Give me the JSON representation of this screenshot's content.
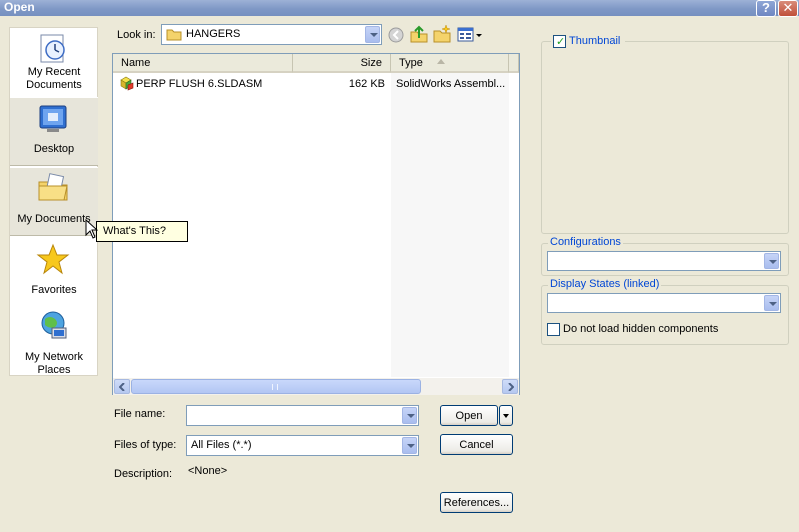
{
  "window": {
    "title": "Open",
    "help_label": "?",
    "close_label": "✕"
  },
  "places": [
    {
      "label_line1": "My Recent",
      "label_line2": "Documents",
      "icon": "recent-documents-icon"
    },
    {
      "label_line1": "Desktop",
      "label_line2": "",
      "icon": "desktop-icon"
    },
    {
      "label_line1": "My Documents",
      "label_line2": "",
      "icon": "my-documents-icon"
    },
    {
      "label_line1": "Favorites",
      "label_line2": "",
      "icon": "favorites-star-icon"
    },
    {
      "label_line1": "My Network",
      "label_line2": "Places",
      "icon": "network-places-icon"
    }
  ],
  "lookin": {
    "label": "Look in:",
    "value": "HANGERS"
  },
  "list": {
    "columns": {
      "name": "Name",
      "size": "Size",
      "type": "Type"
    },
    "rows": [
      {
        "name": "PERP FLUSH 6.SLDASM",
        "size": "162 KB",
        "type": "SolidWorks Assembl..."
      }
    ]
  },
  "fields": {
    "filename_label": "File name:",
    "filename_value": "",
    "filetype_label": "Files of type:",
    "filetype_value": "All Files (*.*)",
    "description_label": "Description:",
    "description_value": "<None>"
  },
  "buttons": {
    "open": "Open",
    "cancel": "Cancel",
    "references": "References..."
  },
  "right_panel": {
    "thumbnail_label": "Thumbnail",
    "configurations_label": "Configurations",
    "display_states_label": "Display States (linked)",
    "hidden_components_label": "Do not load hidden components"
  },
  "tooltip": {
    "text": "What's This?"
  },
  "colors": {
    "titlebar": "#7f98c6",
    "dialog_bg": "#ece9d8",
    "group_title": "#0046d5"
  }
}
